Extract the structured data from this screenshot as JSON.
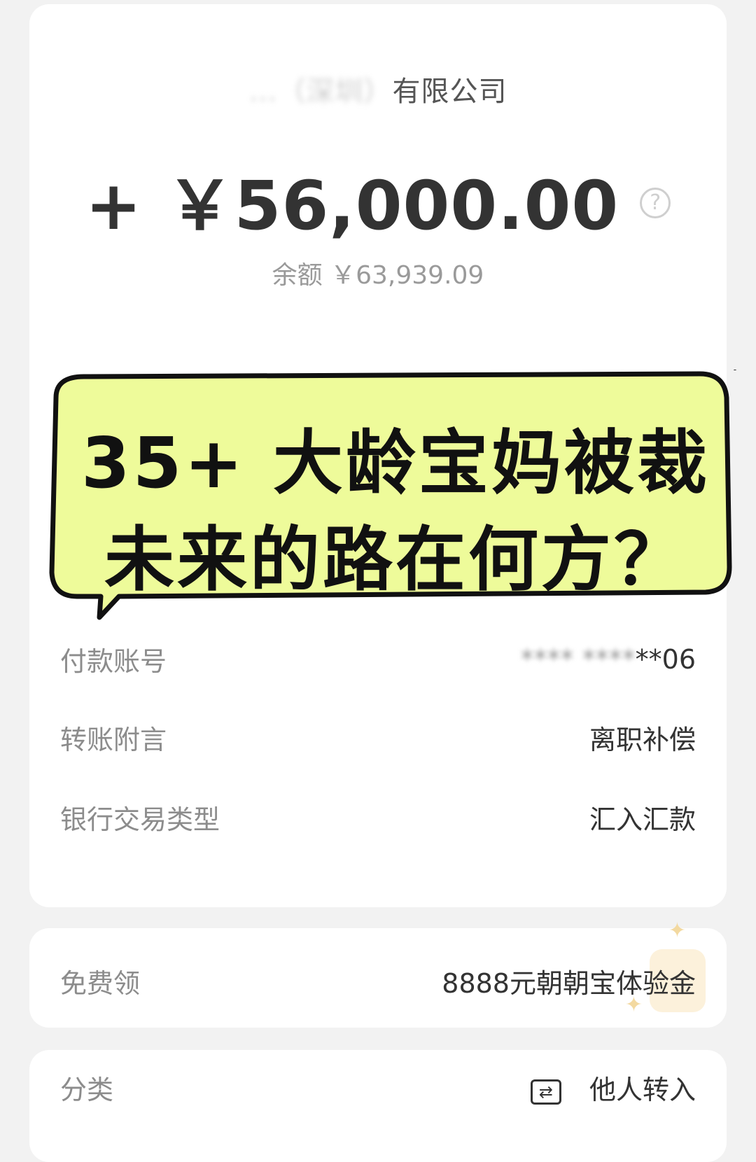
{
  "transaction": {
    "payer_hidden": "…（深圳）",
    "payer_visible": "有限公司",
    "amount": "+ ￥56,000.00",
    "balance": "余额 ￥63,939.09"
  },
  "overlay": {
    "line1": "35+ 大龄宝妈被裁",
    "line2": "未来的路在何方？",
    "fill_color": "#eefb9a"
  },
  "details": [
    {
      "label": "付款账号",
      "value_hidden": "**** ****",
      "value_visible": "**06"
    },
    {
      "label": "转账附言",
      "value": "离职补偿"
    },
    {
      "label": "银行交易类型",
      "value": "汇入汇款"
    }
  ],
  "promo": {
    "label": "免费领",
    "value": "8888元朝朝宝体验金"
  },
  "category": {
    "label": "分类",
    "icon": "transfer-icon",
    "value": "他人转入"
  }
}
